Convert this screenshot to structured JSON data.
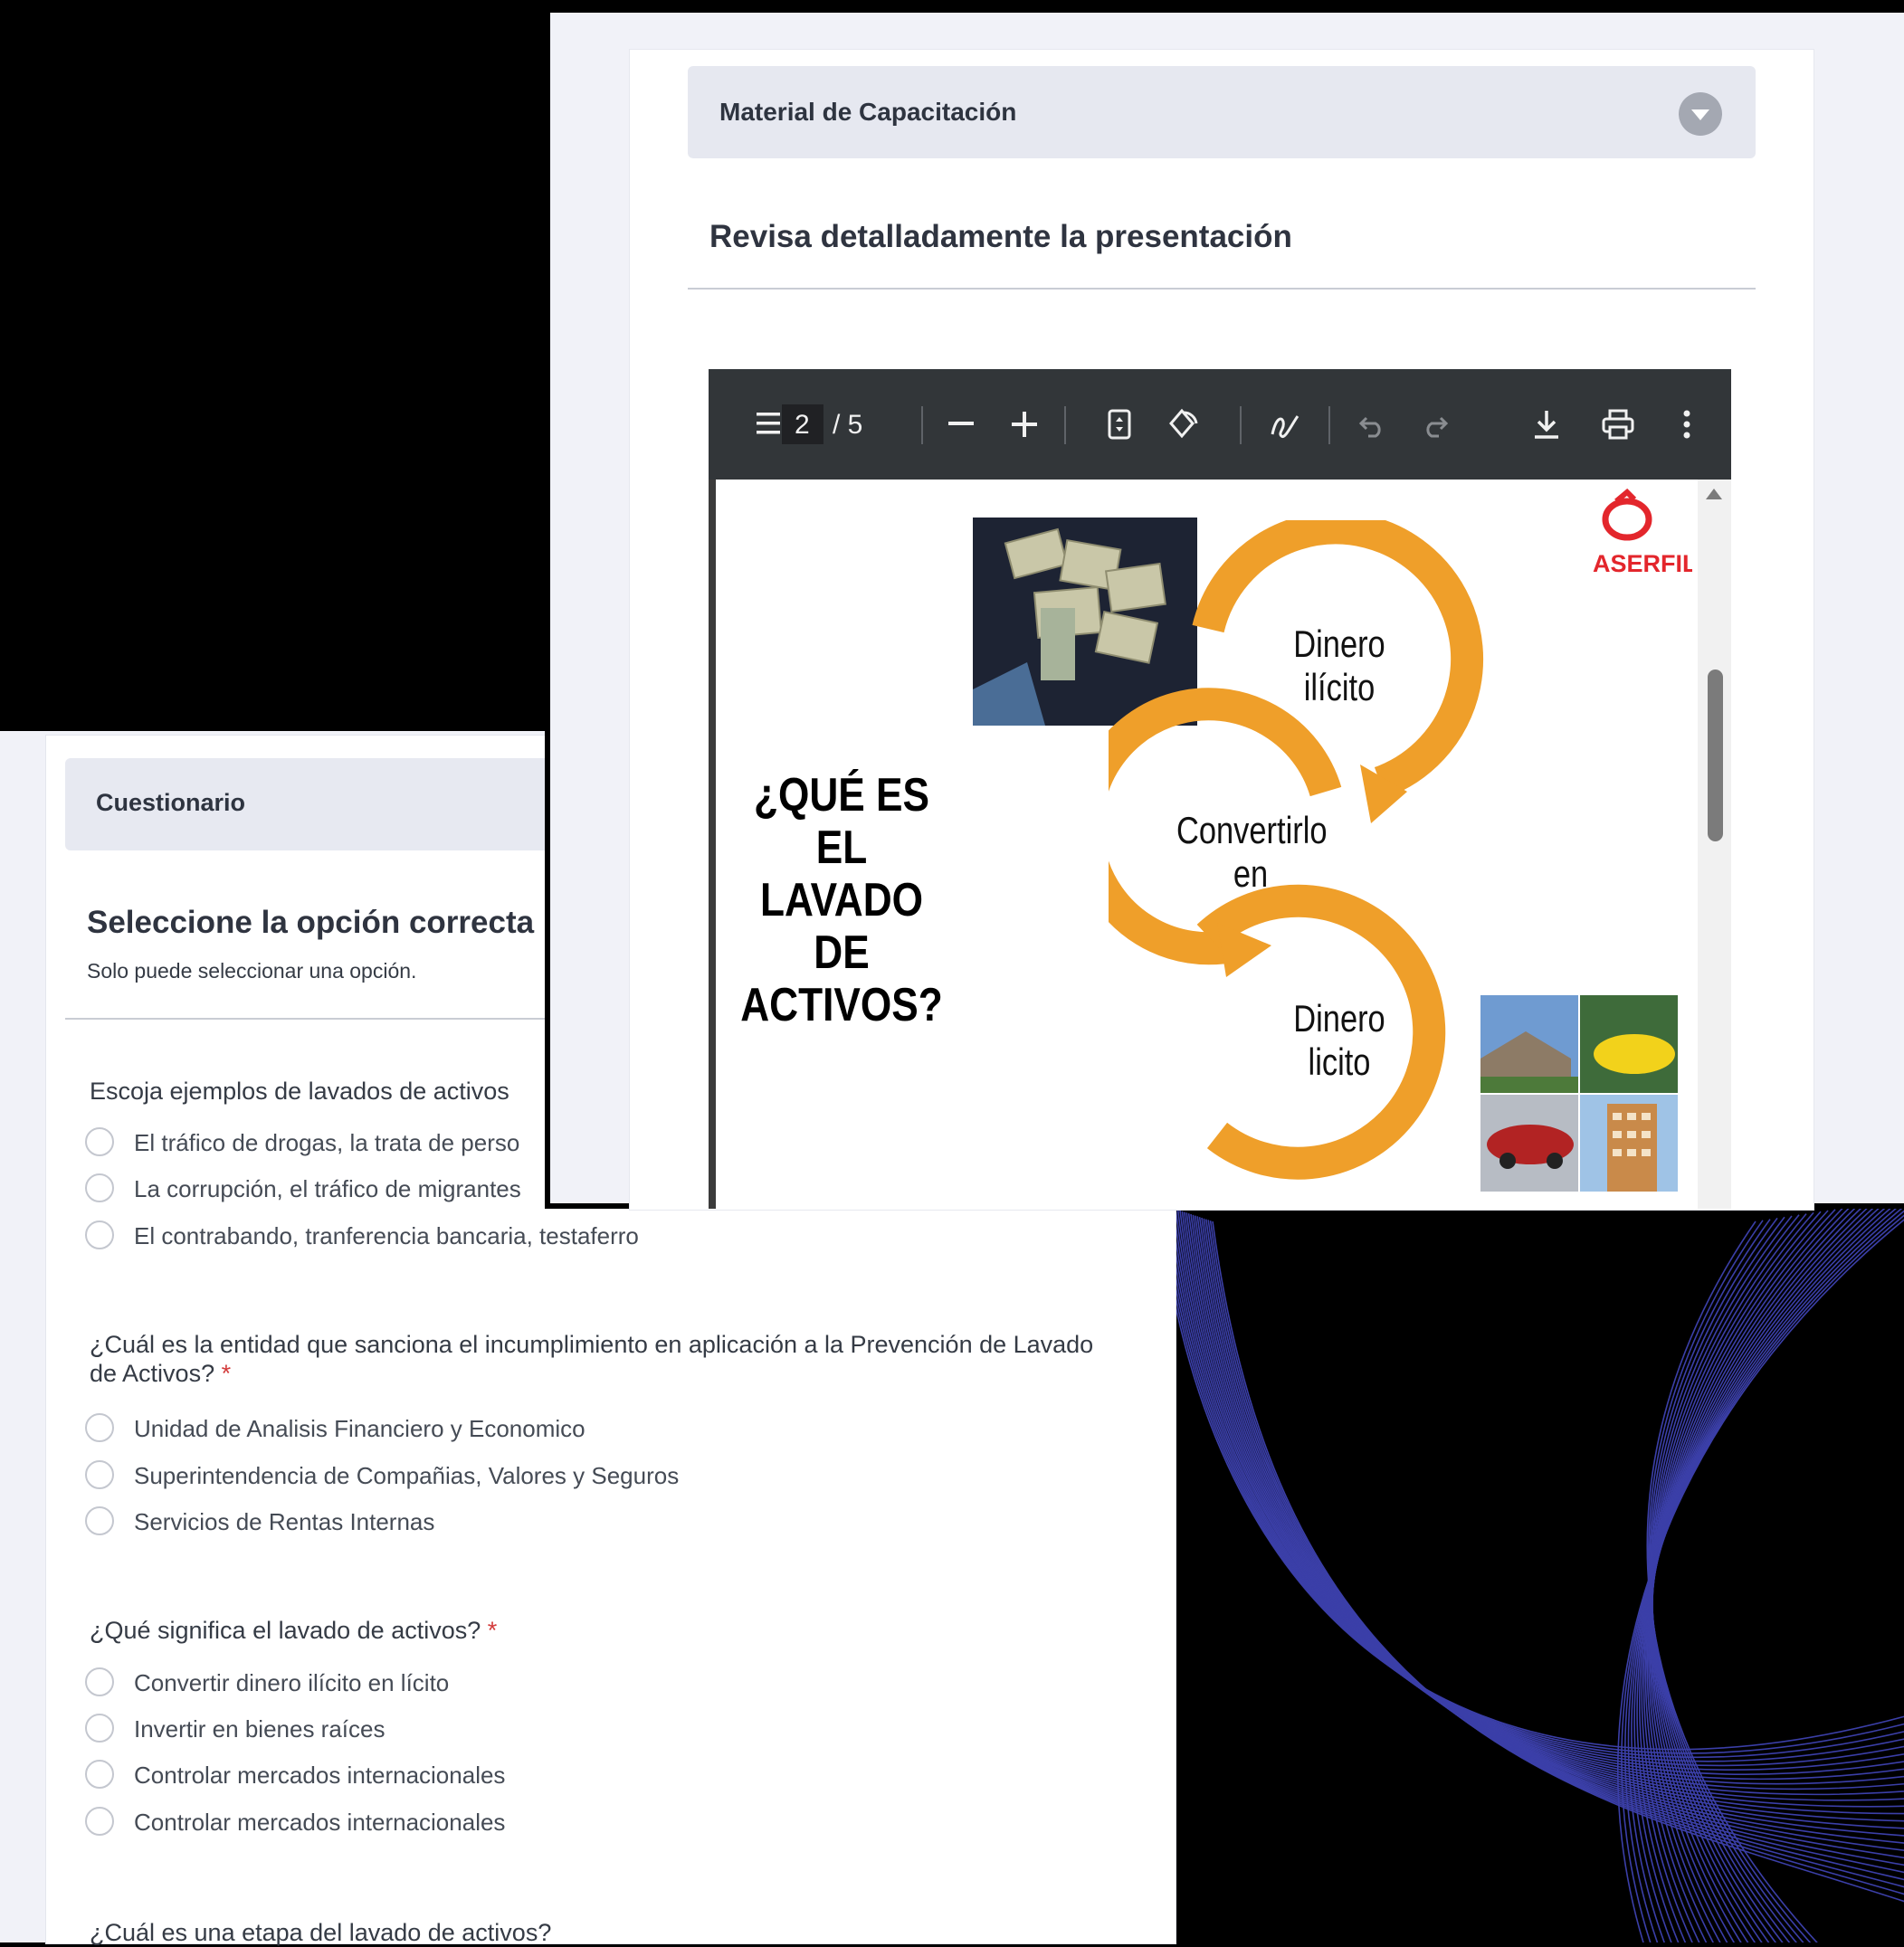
{
  "material": {
    "section_title": "Material de Capacitación",
    "heading": "Revisa detalladamente la presentación",
    "viewer": {
      "current_page": "2",
      "page_total": "/ 5"
    },
    "slide": {
      "title_lines": [
        "¿QUÉ ES",
        "EL",
        "LAVADO",
        "DE",
        "ACTIVOS?"
      ],
      "logo_text": "ASERFIL",
      "cycle": {
        "top": [
          "Dinero",
          "ilícito"
        ],
        "middle": [
          "Convertirlo",
          "en"
        ],
        "bottom": [
          "Dinero",
          "licito"
        ]
      },
      "colors": {
        "arrow": "#ef9f2a",
        "logo": "#e3262c"
      }
    }
  },
  "quiz": {
    "section_title": "Cuestionario",
    "heading": "Seleccione la opción correcta",
    "subheading": "Solo puede seleccionar una opción.",
    "questions": [
      {
        "text": "Escoja ejemplos de lavados de activos",
        "options": [
          "El tráfico de drogas, la trata de perso",
          "La corrupción, el tráfico de migrantes",
          "El contrabando, tranferencia bancaria, testaferro"
        ]
      },
      {
        "text": "¿Cuál es la entidad que sanciona el incumplimiento en aplicación a la Prevención de Lavado de Activos?",
        "required": "*",
        "options": [
          "Unidad de Analisis Financiero y Economico",
          "Superintendencia de Compañias, Valores y Seguros",
          "Servicios de Rentas Internas"
        ]
      },
      {
        "text": "¿Qué significa el lavado de activos?",
        "required": "*",
        "options": [
          "Convertir dinero ilícito en lícito",
          "Invertir en bienes raíces",
          "Controlar mercados internacionales",
          "Controlar mercados internacionales"
        ]
      },
      {
        "text": "¿Cuál es una etapa del lavado de activos?"
      }
    ]
  }
}
